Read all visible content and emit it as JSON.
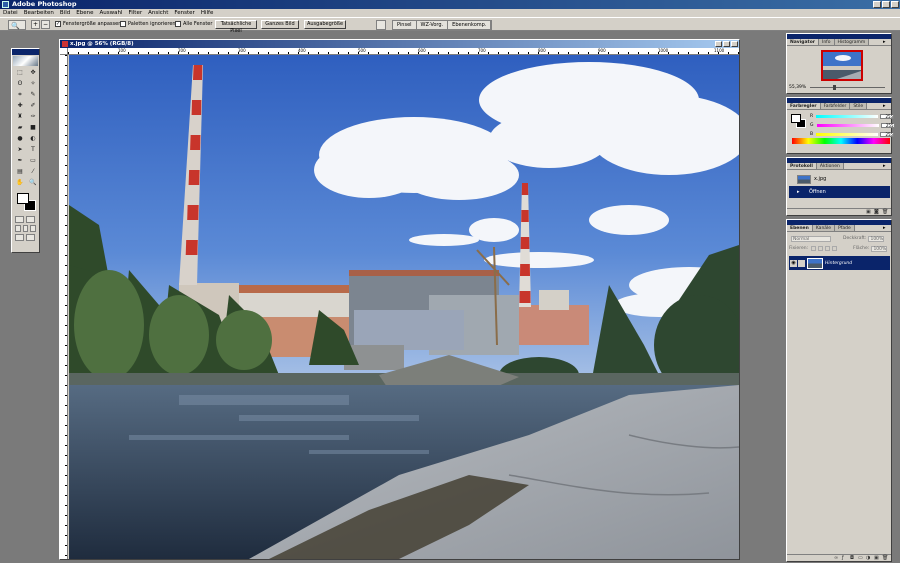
{
  "app": {
    "title": "Adobe Photoshop"
  },
  "menu": [
    "Datei",
    "Bearbeiten",
    "Bild",
    "Ebene",
    "Auswahl",
    "Filter",
    "Ansicht",
    "Fenster",
    "Hilfe"
  ],
  "options": {
    "checkbox_fit": "Fenstergröße anpassen",
    "checkbox_ignore_palettes": "Paletten ignorieren",
    "checkbox_all_windows": "Alle Fenster",
    "btn_actual_pixels": "Tatsächliche Pixel",
    "btn_fit_screen": "Ganzes Bild",
    "btn_print_size": "Ausgabegröße",
    "palette_well": [
      "Pinsel",
      "WZ-Vorg.",
      "Ebenenkomp."
    ]
  },
  "document": {
    "title": "x.jpg @ 56% (RGB/8)",
    "ruler_labels": [
      "100",
      "200",
      "300",
      "400",
      "500",
      "600",
      "700",
      "800",
      "900",
      "1000",
      "1100"
    ]
  },
  "navigator": {
    "tabs": [
      "Navigator",
      "Info",
      "Histogramm"
    ],
    "zoom": "55,39%"
  },
  "color": {
    "tabs": [
      "Farbregler",
      "Farbfelder",
      "Stile"
    ],
    "channels": [
      {
        "label": "R",
        "value": "255",
        "color": "#ff4040"
      },
      {
        "label": "G",
        "value": "255",
        "color": "#40c040"
      },
      {
        "label": "B",
        "value": "255",
        "color": "#4060ff"
      }
    ]
  },
  "history": {
    "tabs": [
      "Protokoll",
      "Aktionen"
    ],
    "snapshot": "x.jpg",
    "items": [
      "Öffnen"
    ]
  },
  "layers": {
    "tabs": [
      "Ebenen",
      "Kanäle",
      "Pfade"
    ],
    "blend_mode": "Normal",
    "opacity_label": "Deckkraft:",
    "opacity": "100%",
    "lock_label": "Fixieren:",
    "fill_label": "Fläche:",
    "fill": "100%",
    "layer_name": "Hintergrund"
  }
}
